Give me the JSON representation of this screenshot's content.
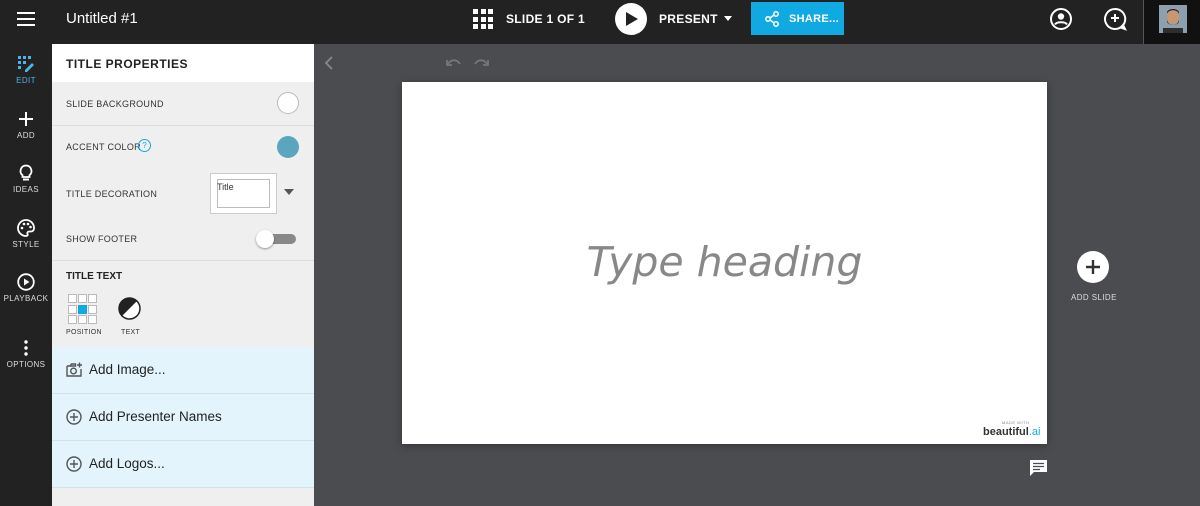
{
  "topbar": {
    "doc_title": "Untitled #1",
    "slide_counter": "SLIDE 1 OF 1",
    "present_label": "PRESENT",
    "share_label": "SHARE..."
  },
  "rail": {
    "items": [
      {
        "label": "EDIT",
        "icon": "edit-grid-icon",
        "active": true
      },
      {
        "label": "ADD",
        "icon": "plus-icon"
      },
      {
        "label": "IDEAS",
        "icon": "lightbulb-icon"
      },
      {
        "label": "STYLE",
        "icon": "palette-icon"
      },
      {
        "label": "PLAYBACK",
        "icon": "play-circle-icon"
      },
      {
        "label": "OPTIONS",
        "icon": "more-vertical-icon"
      }
    ]
  },
  "panel": {
    "header": "TITLE PROPERTIES",
    "slide_background_label": "SLIDE BACKGROUND",
    "slide_background_color": "#ffffff",
    "accent_color_label": "ACCENT COLOR",
    "accent_color": "#5ba5bf",
    "help_glyph": "?",
    "title_decoration_label": "TITLE DECORATION",
    "title_decoration_value": "Title",
    "show_footer_label": "SHOW FOOTER",
    "show_footer_on": false,
    "title_text_header": "TITLE TEXT",
    "position_label": "POSITION",
    "text_label": "TEXT",
    "actions": [
      {
        "label": "Add Image...",
        "icon": "add-photo-icon"
      },
      {
        "label": "Add Presenter Names",
        "icon": "add-circle-icon"
      },
      {
        "label": "Add Logos...",
        "icon": "add-circle-icon"
      }
    ]
  },
  "slide": {
    "heading_placeholder": "Type heading",
    "made_with": "MADE WITH",
    "brand_name": "beautiful",
    "brand_suffix": ".ai"
  },
  "add_slide_label": "ADD SLIDE",
  "colors": {
    "accent": "#11a9e2",
    "topbar": "#222222",
    "canvas_bg": "#4a4c50",
    "action_bg": "#e3f4fc"
  }
}
